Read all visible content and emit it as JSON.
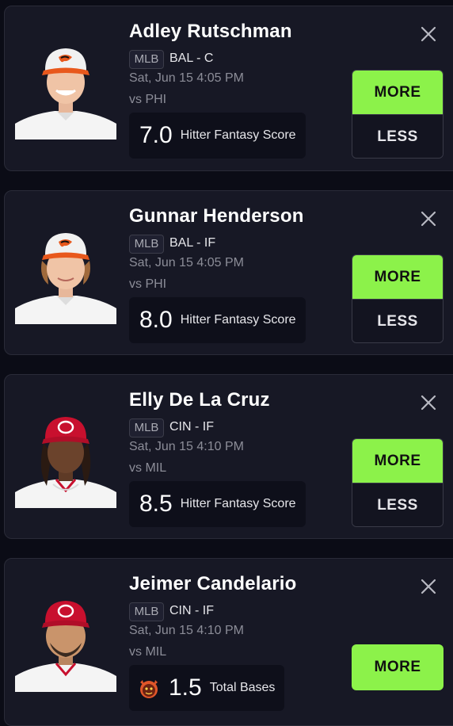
{
  "cards": [
    {
      "player_name": "Adley Rutschman",
      "league": "MLB",
      "team_position": "BAL - C",
      "game_time": "Sat, Jun 15 4:05 PM",
      "opponent": "vs PHI",
      "line_value": "7.0",
      "stat_type": "Hitter Fantasy Score",
      "more_label": "MORE",
      "less_label": "LESS",
      "cap_color": "#f1f1f1",
      "brim_color": "#e8581c",
      "logo": "orioles-bird"
    },
    {
      "player_name": "Gunnar Henderson",
      "league": "MLB",
      "team_position": "BAL - IF",
      "game_time": "Sat, Jun 15 4:05 PM",
      "opponent": "vs PHI",
      "line_value": "8.0",
      "stat_type": "Hitter Fantasy Score",
      "more_label": "MORE",
      "less_label": "LESS",
      "cap_color": "#f1f1f1",
      "brim_color": "#e8581c",
      "logo": "orioles-bird"
    },
    {
      "player_name": "Elly De La Cruz",
      "league": "MLB",
      "team_position": "CIN - IF",
      "game_time": "Sat, Jun 15 4:10 PM",
      "opponent": "vs MIL",
      "line_value": "8.5",
      "stat_type": "Hitter Fantasy Score",
      "more_label": "MORE",
      "less_label": "LESS",
      "cap_color": "#c8102e",
      "brim_color": "#b00e28",
      "logo": "reds-c"
    },
    {
      "player_name": "Jeimer Candelario",
      "league": "MLB",
      "team_position": "CIN - IF",
      "game_time": "Sat, Jun 15 4:10 PM",
      "opponent": "vs MIL",
      "line_value": "1.5",
      "stat_type": "Total Bases",
      "more_label": "MORE",
      "cap_color": "#c8102e",
      "brim_color": "#b00e28",
      "logo": "reds-c",
      "badge_icon": "goblin-icon"
    }
  ],
  "colors": {
    "more_button": "#8cf24a",
    "card_background": "#171825",
    "page_background": "#0b0c16"
  }
}
